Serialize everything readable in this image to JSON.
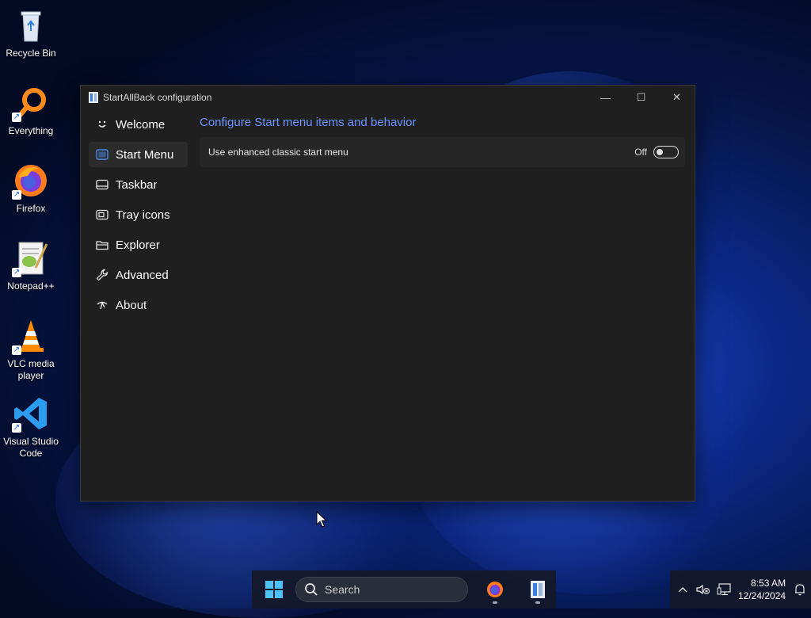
{
  "desktop": {
    "icons": [
      {
        "label": "Recycle Bin"
      },
      {
        "label": "Everything"
      },
      {
        "label": "Firefox"
      },
      {
        "label": "Notepad++"
      },
      {
        "label": "VLC media player"
      },
      {
        "label": "Visual Studio Code"
      }
    ]
  },
  "window": {
    "title": "StartAllBack configuration",
    "controls": {
      "minimize": "—",
      "maximize": "☐",
      "close": "✕"
    },
    "sidebar": {
      "items": [
        {
          "label": "Welcome",
          "icon": "smile-icon"
        },
        {
          "label": "Start Menu",
          "icon": "start-menu-icon",
          "selected": true
        },
        {
          "label": "Taskbar",
          "icon": "taskbar-icon"
        },
        {
          "label": "Tray icons",
          "icon": "tray-icons-icon"
        },
        {
          "label": "Explorer",
          "icon": "folder-icon"
        },
        {
          "label": "Advanced",
          "icon": "wrench-icon"
        },
        {
          "label": "About",
          "icon": "about-icon"
        }
      ]
    },
    "content": {
      "heading": "Configure Start menu items and behavior",
      "settings": [
        {
          "label": "Use enhanced classic start menu",
          "state_label": "Off",
          "enabled": false
        }
      ]
    }
  },
  "taskbar": {
    "search_label": "Search",
    "apps": [
      "firefox-icon",
      "startallback-icon"
    ],
    "time": "8:53 AM",
    "date": "12/24/2024"
  },
  "colors": {
    "accent": "#6f93ff",
    "window_bg": "#1f1f1f",
    "selected_bg": "#2b2b2b"
  }
}
